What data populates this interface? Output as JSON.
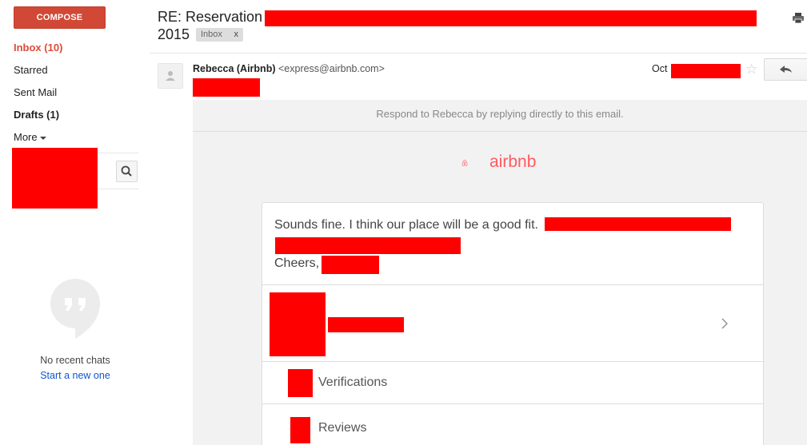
{
  "sidebar": {
    "compose_label": "COMPOSE",
    "items": [
      {
        "label": "Inbox (10)"
      },
      {
        "label": "Starred"
      },
      {
        "label": "Sent Mail"
      },
      {
        "label": "Drafts (1)"
      },
      {
        "label": "More"
      }
    ],
    "chat": {
      "empty_text": "No recent chats",
      "start_link": "Start a new one"
    }
  },
  "header": {
    "subject_start": "RE: Reservation",
    "subject_end": "2015",
    "label": "Inbox",
    "label_remove": "x"
  },
  "message": {
    "sender_name": "Rebecca (Airbnb)",
    "sender_email": "<express@airbnb.com>",
    "date_prefix": "Oct"
  },
  "body": {
    "respond_note": "Respond to Rebecca by replying directly to this email.",
    "brand": "airbnb",
    "message_line1": "Sounds fine. I think our place will be a good fit.",
    "message_closing": "Cheers,",
    "rows": [
      {
        "label": "Verifications"
      },
      {
        "label": "Reviews"
      }
    ]
  },
  "colors": {
    "compose": "#d14836",
    "inbox_active": "#dd4b39",
    "link": "#1155cc",
    "airbnb": "#ff5a5f",
    "redaction": "#ff0000"
  },
  "icons": [
    "search-icon",
    "hangouts-icon",
    "print-icon",
    "star-icon",
    "reply-icon",
    "avatar-icon",
    "airbnb-logo-icon",
    "chevron-right-icon"
  ]
}
